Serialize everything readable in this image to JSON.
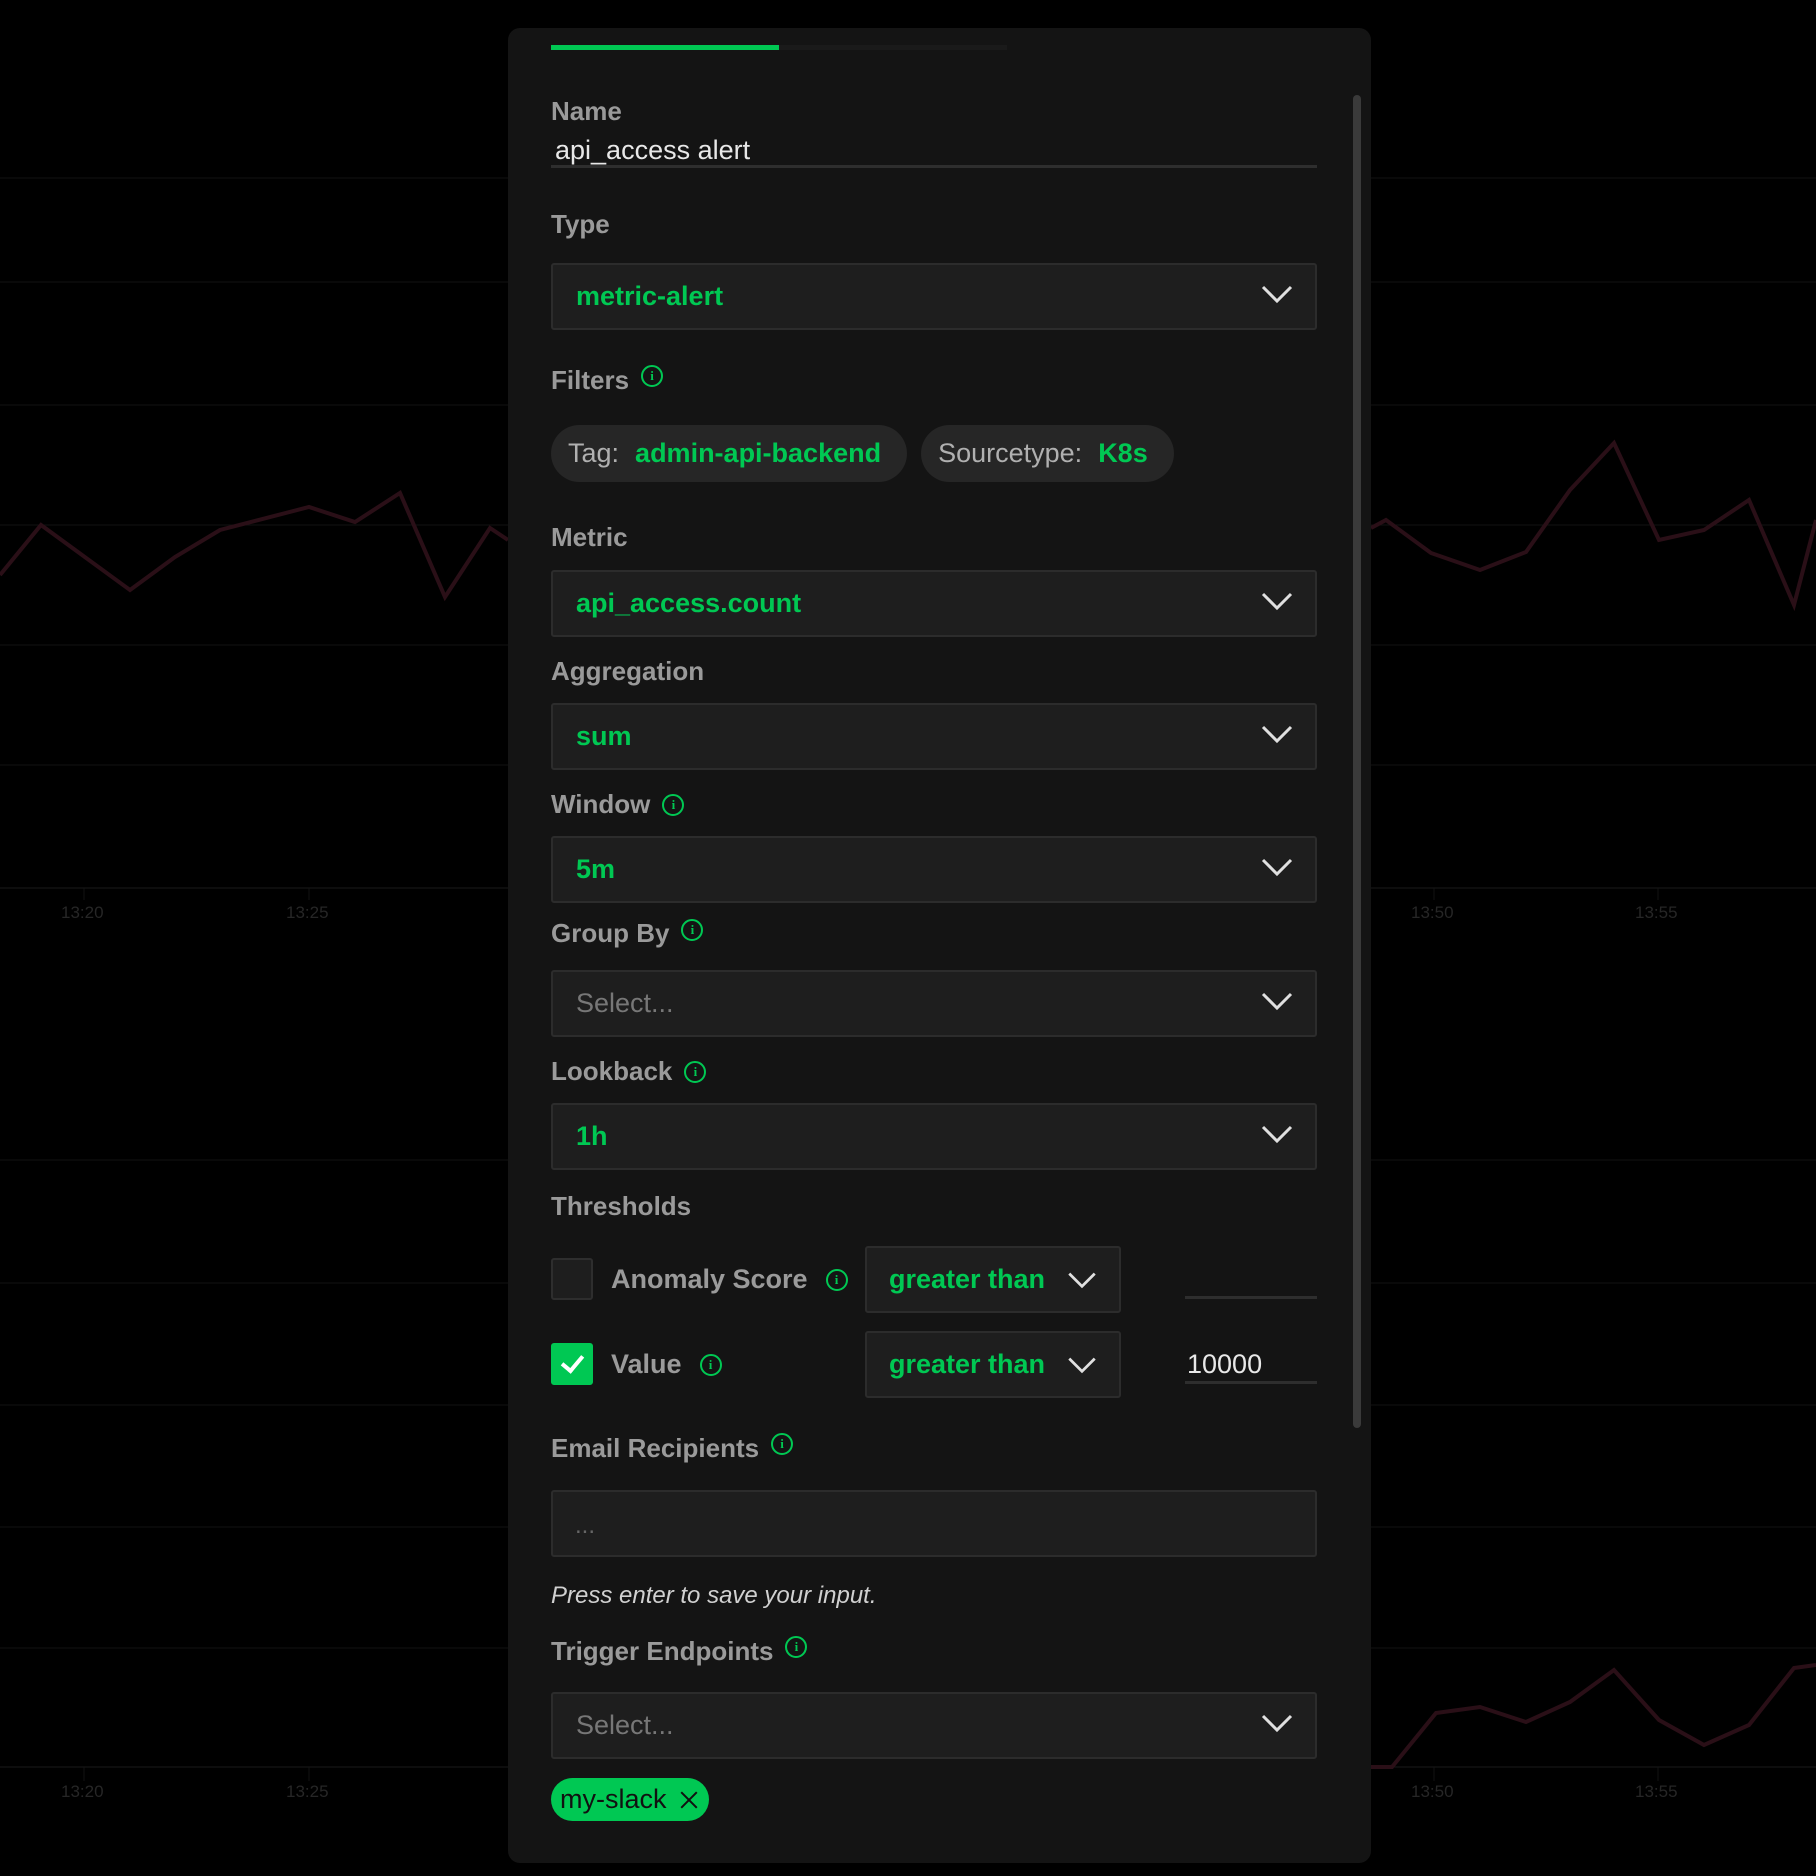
{
  "background_charts": {
    "x_ticks": [
      "13:20",
      "13:25",
      "13:50",
      "13:55"
    ]
  },
  "modal": {
    "progress_fraction": 0.5,
    "name": {
      "label": "Name",
      "value": "api_access alert"
    },
    "type": {
      "label": "Type",
      "value": "metric-alert"
    },
    "filters": {
      "label": "Filters",
      "chips": [
        {
          "key": "Tag:",
          "value": "admin-api-backend"
        },
        {
          "key": "Sourcetype:",
          "value": "K8s"
        }
      ]
    },
    "metric": {
      "label": "Metric",
      "value": "api_access.count"
    },
    "aggregation": {
      "label": "Aggregation",
      "value": "sum"
    },
    "window": {
      "label": "Window",
      "value": "5m"
    },
    "group_by": {
      "label": "Group By",
      "placeholder": "Select..."
    },
    "lookback": {
      "label": "Lookback",
      "value": "1h"
    },
    "thresholds": {
      "label": "Thresholds",
      "rows": [
        {
          "label": "Anomaly Score",
          "checked": false,
          "comparator": "greater than",
          "value": ""
        },
        {
          "label": "Value",
          "checked": true,
          "comparator": "greater than",
          "value": "10000"
        }
      ]
    },
    "email_recipients": {
      "label": "Email Recipients",
      "placeholder": "...",
      "hint": "Press enter to save your input."
    },
    "trigger_endpoints": {
      "label": "Trigger Endpoints",
      "placeholder": "Select...",
      "selected": [
        "my-slack"
      ]
    }
  },
  "colors": {
    "accent": "#00c853",
    "panel": "#141414",
    "field": "#1e1e1e",
    "chart_line": "#2a0f17"
  },
  "icons": {
    "info": "info-circle-icon",
    "dropdown": "chevron-down-icon",
    "remove": "close-icon",
    "check": "checkmark-icon"
  }
}
